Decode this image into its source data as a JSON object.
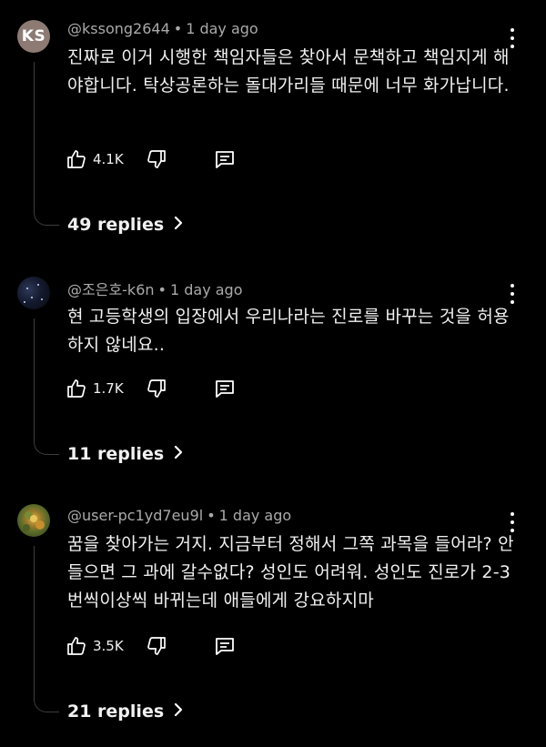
{
  "comments": [
    {
      "avatar": {
        "type": "initials",
        "initials": "KS",
        "color": "#8d7b73"
      },
      "handle": "@kssong2644",
      "time": "1 day ago",
      "text": "진짜로 이거 시행한 책임자들은 찾아서 문책하고 책임지게 해야합니다. 탁상공론하는 돌대가리들 때문에 너무 화가납니다.",
      "likes": "4.1K",
      "replies": "49 replies"
    },
    {
      "avatar": {
        "type": "space-photo"
      },
      "handle": "@조은호-k6n",
      "time": "1 day ago",
      "text": "현 고등학생의 입장에서 우리나라는 진로를 바꾸는 것을 허용하지 않네요..",
      "likes": "1.7K",
      "replies": "11 replies"
    },
    {
      "avatar": {
        "type": "plant-photo"
      },
      "handle": "@user-pc1yd7eu9l",
      "time": "1 day ago",
      "text": "꿈을 찾아가는 거지. 지금부터 정해서 그쪽 과목을 들어라? 안 들으면 그 과에 갈수없다? 성인도 어려워. 성인도 진로가 2-3번씩이상씩 바뀌는데 애들에게 강요하지마",
      "likes": "3.5K",
      "replies": "21 replies"
    }
  ],
  "icons": {
    "like": "thumbs-up-icon",
    "dislike": "thumbs-down-icon",
    "reply": "comment-icon",
    "menu": "more-vert-icon",
    "chevron": "chevron-right-icon"
  },
  "colors": {
    "background": "#000000",
    "meta": "#aaaaaa",
    "text": "#f1f1f1",
    "thread": "#3d3d3d"
  }
}
